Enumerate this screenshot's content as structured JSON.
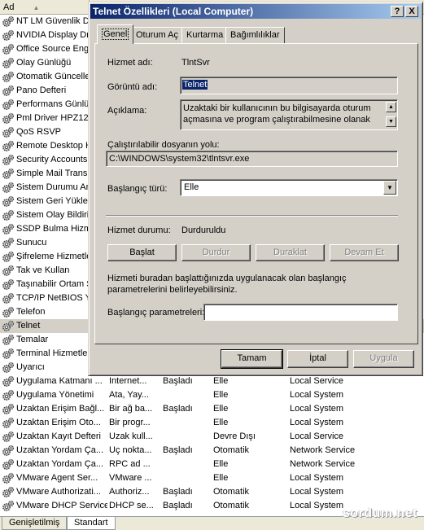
{
  "list": {
    "header_name": "Ad",
    "rows": [
      {
        "name": "NT LM Güvenlik De",
        "desc": "",
        "status": "",
        "startup": "",
        "logon": ""
      },
      {
        "name": "NVIDIA Display Dr",
        "desc": "",
        "status": "",
        "startup": "",
        "logon": ""
      },
      {
        "name": "Office Source Eng",
        "desc": "",
        "status": "",
        "startup": "",
        "logon": ""
      },
      {
        "name": "Olay Günlüğü",
        "desc": "",
        "status": "",
        "startup": "",
        "logon": ""
      },
      {
        "name": "Otomatik Güncelle",
        "desc": "",
        "status": "",
        "startup": "",
        "logon": ""
      },
      {
        "name": "Pano Defteri",
        "desc": "",
        "status": "",
        "startup": "",
        "logon": ""
      },
      {
        "name": "Performans Günlü",
        "desc": "",
        "status": "",
        "startup": "",
        "logon": ""
      },
      {
        "name": "Pml Driver HPZ12",
        "desc": "",
        "status": "",
        "startup": "",
        "logon": ""
      },
      {
        "name": "QoS RSVP",
        "desc": "",
        "status": "",
        "startup": "",
        "logon": ""
      },
      {
        "name": "Remote Desktop H",
        "desc": "",
        "status": "",
        "startup": "",
        "logon": ""
      },
      {
        "name": "Security Accounts",
        "desc": "",
        "status": "",
        "startup": "",
        "logon": ""
      },
      {
        "name": "Simple Mail Transp",
        "desc": "",
        "status": "",
        "startup": "",
        "logon": ""
      },
      {
        "name": "Sistem Durumu An",
        "desc": "",
        "status": "",
        "startup": "",
        "logon": ""
      },
      {
        "name": "Sistem Geri Yüklem",
        "desc": "",
        "status": "",
        "startup": "",
        "logon": ""
      },
      {
        "name": "Sistem Olay Bildirir",
        "desc": "",
        "status": "",
        "startup": "",
        "logon": ""
      },
      {
        "name": "SSDP Bulma Hizme",
        "desc": "",
        "status": "",
        "startup": "",
        "logon": ""
      },
      {
        "name": "Sunucu",
        "desc": "",
        "status": "",
        "startup": "",
        "logon": ""
      },
      {
        "name": "Şifreleme Hizmetle",
        "desc": "",
        "status": "",
        "startup": "",
        "logon": ""
      },
      {
        "name": "Tak ve Kullan",
        "desc": "",
        "status": "",
        "startup": "",
        "logon": ""
      },
      {
        "name": "Taşınabilir Ortam S",
        "desc": "",
        "status": "",
        "startup": "",
        "logon": ""
      },
      {
        "name": "TCP/IP NetBIOS Y",
        "desc": "",
        "status": "",
        "startup": "",
        "logon": ""
      },
      {
        "name": "Telefon",
        "desc": "",
        "status": "",
        "startup": "",
        "logon": ""
      },
      {
        "name": "Telnet",
        "desc": "",
        "status": "",
        "startup": "",
        "logon": "",
        "selected": true
      },
      {
        "name": "Temalar",
        "desc": "",
        "status": "",
        "startup": "",
        "logon": ""
      },
      {
        "name": "Terminal Hizmetler",
        "desc": "",
        "status": "",
        "startup": "",
        "logon": ""
      },
      {
        "name": "Uyarıcı",
        "desc": "",
        "status": "",
        "startup": "",
        "logon": ""
      },
      {
        "name": "Uygulama Katmanı ...",
        "desc": "Internet...",
        "status": "Başladı",
        "startup": "Elle",
        "logon": "Local Service"
      },
      {
        "name": "Uygulama Yönetimi",
        "desc": "Ata, Yay...",
        "status": "",
        "startup": "Elle",
        "logon": "Local System"
      },
      {
        "name": "Uzaktan Erişim Bağl...",
        "desc": "Bir ağ ba...",
        "status": "Başladı",
        "startup": "Elle",
        "logon": "Local System"
      },
      {
        "name": "Uzaktan Erişim Oto...",
        "desc": "Bir progr...",
        "status": "",
        "startup": "Elle",
        "logon": "Local System"
      },
      {
        "name": "Uzaktan Kayıt Defteri",
        "desc": "Uzak kull...",
        "status": "",
        "startup": "Devre Dışı",
        "logon": "Local Service"
      },
      {
        "name": "Uzaktan Yordam Ça...",
        "desc": "Uç nokta...",
        "status": "Başladı",
        "startup": "Otomatik",
        "logon": "Network Service"
      },
      {
        "name": "Uzaktan Yordam Ça...",
        "desc": "RPC ad ...",
        "status": "",
        "startup": "Elle",
        "logon": "Network Service"
      },
      {
        "name": "VMware Agent Ser...",
        "desc": "VMware ...",
        "status": "",
        "startup": "Elle",
        "logon": "Local System"
      },
      {
        "name": "VMware Authorizati...",
        "desc": "Authoriz...",
        "status": "Başladı",
        "startup": "Otomatik",
        "logon": "Local System"
      },
      {
        "name": "VMware DHCP Service",
        "desc": "DHCP se...",
        "status": "Başladı",
        "startup": "Otomatik",
        "logon": "Local System"
      }
    ]
  },
  "bottom_tabs": [
    "Genişletilmiş",
    "Standart"
  ],
  "watermark": "sordum.net",
  "dialog": {
    "title": "Telnet Özellikleri (Local Computer)",
    "help_btn": "?",
    "close_btn": "X",
    "tabs": [
      "Genel",
      "Oturum Aç",
      "Kurtarma",
      "Bağımlılıklar"
    ],
    "service_name_label": "Hizmet adı:",
    "service_name": "TlntSvr",
    "display_name_label": "Görüntü adı:",
    "display_name": "Telnet",
    "description_label": "Açıklama:",
    "description": "Uzaktaki bir kullanıcının bu bilgisayarda oturum açmasına ve program çalıştırabilmesine olanak sağlar",
    "exe_path_label": "Çalıştırılabilir dosyanın yolu:",
    "exe_path": "C:\\WINDOWS\\system32\\tlntsvr.exe",
    "startup_type_label": "Başlangıç türü:",
    "startup_type": "Elle",
    "service_status_label": "Hizmet durumu:",
    "service_status": "Durduruldu",
    "btn_start": "Başlat",
    "btn_stop": "Durdur",
    "btn_pause": "Duraklat",
    "btn_resume": "Devam Et",
    "start_params_help": "Hizmeti buradan başlattığınızda uygulanacak olan başlangıç parametrelerini belirleyebilirsiniz.",
    "start_params_label": "Başlangıç parametreleri:",
    "start_params_value": "",
    "btn_ok": "Tamam",
    "btn_cancel": "İptal",
    "btn_apply": "Uygula"
  }
}
